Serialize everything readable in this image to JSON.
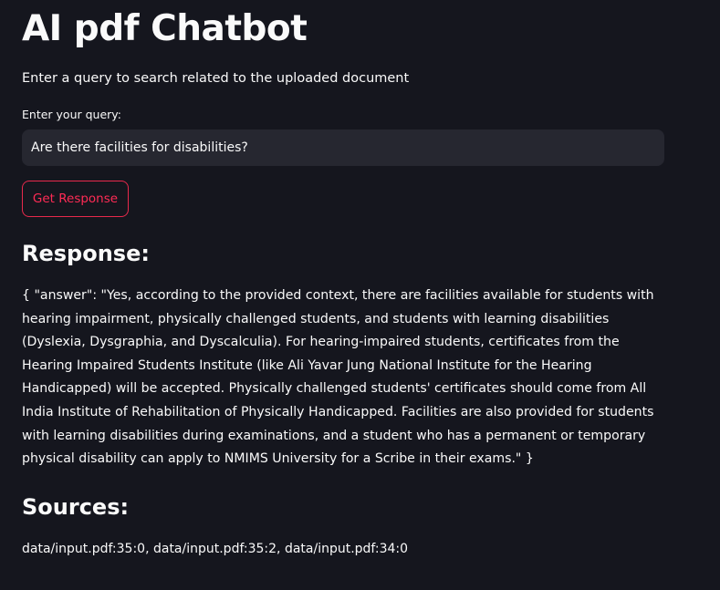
{
  "header": {
    "title": "AI pdf Chatbot",
    "subtitle": "Enter a query to search related to the uploaded document"
  },
  "query": {
    "label": "Enter your query:",
    "value": "Are there facilities for disabilities?"
  },
  "actions": {
    "get_response_label": "Get Response"
  },
  "response": {
    "heading": "Response:",
    "text": "{ \"answer\": \"Yes, according to the provided context, there are facilities available for students with hearing impairment, physically challenged students, and students with learning disabilities (Dyslexia, Dysgraphia, and Dyscalculia). For hearing-impaired students, certificates from the Hearing Impaired Students Institute (like Ali Yavar Jung National Institute for the Hearing Handicapped) will be accepted. Physically challenged students' certificates should come from All India Institute of Rehabilitation of Physically Handicapped. Facilities are also provided for students with learning disabilities during examinations, and a student who has a permanent or temporary physical disability can apply to NMIMS University for a Scribe in their exams.\" }"
  },
  "sources": {
    "heading": "Sources:",
    "text": "data/input.pdf:35:0, data/input.pdf:35:2, data/input.pdf:34:0"
  },
  "colors": {
    "background": "#15161e",
    "input_background": "#262730",
    "text": "#fafafa",
    "accent": "#ff2b55"
  }
}
